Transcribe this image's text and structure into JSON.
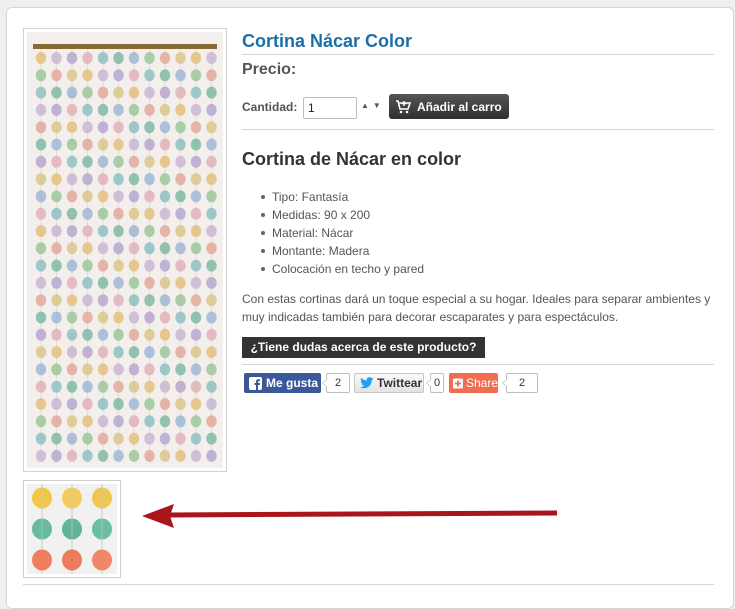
{
  "product": {
    "title": "Cortina Nácar Color",
    "price_label": "Precio:",
    "quantity_label": "Cantidad:",
    "quantity_value": "1",
    "add_to_cart_label": "Añadir al carro",
    "description_title": "Cortina de Nácar en color",
    "features": [
      "Tipo: Fantasía",
      "Medidas: 90 x 200",
      "Material: Nácar",
      "Montante: Madera",
      "Colocación en techo y pared"
    ],
    "description": "Con estas cortinas dará un toque especial a su hogar. Ideales para separar ambientes y muy indicadas también para decorar escaparates y para espectáculos.",
    "ask_button_label": "¿Tiene dudas acerca de este producto?"
  },
  "social": {
    "facebook": {
      "label": "Me gusta",
      "count": "2",
      "icon": "facebook-icon",
      "color": "#3b5998"
    },
    "twitter": {
      "label": "Twittear",
      "count": "0",
      "icon": "twitter-icon",
      "color": "#1da1f2"
    },
    "share": {
      "label": "Share",
      "count": "2",
      "icon": "share-plus-icon",
      "color": "#ee6e4f"
    }
  },
  "images": {
    "main": "curtain-photo",
    "thumbnail": "curtain-detail-photo",
    "annotation": "red-arrow-pointing-left",
    "annotation_color": "#a8161c"
  },
  "colors": {
    "title": "#1b6fa8",
    "cart_button": "#3a3a3a",
    "ask_button": "#333333"
  }
}
